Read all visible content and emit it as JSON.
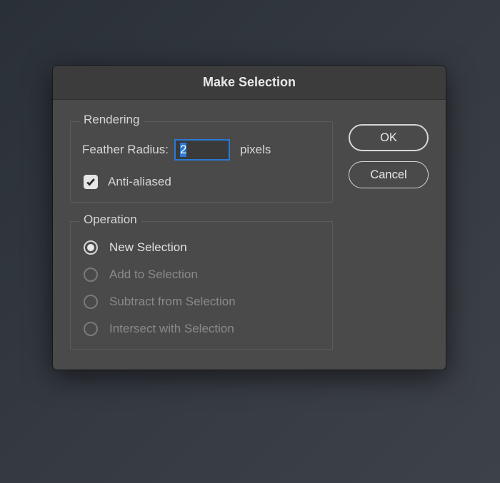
{
  "dialog": {
    "title": "Make Selection"
  },
  "rendering": {
    "legend": "Rendering",
    "feather_label": "Feather Radius:",
    "feather_value": "2",
    "feather_unit": "pixels",
    "antialiased_label": "Anti-aliased",
    "antialiased_checked": true
  },
  "operation": {
    "legend": "Operation",
    "options": [
      {
        "label": "New Selection",
        "enabled": true,
        "selected": true
      },
      {
        "label": "Add to Selection",
        "enabled": false,
        "selected": false
      },
      {
        "label": "Subtract from Selection",
        "enabled": false,
        "selected": false
      },
      {
        "label": "Intersect with Selection",
        "enabled": false,
        "selected": false
      }
    ]
  },
  "buttons": {
    "ok": "OK",
    "cancel": "Cancel"
  }
}
